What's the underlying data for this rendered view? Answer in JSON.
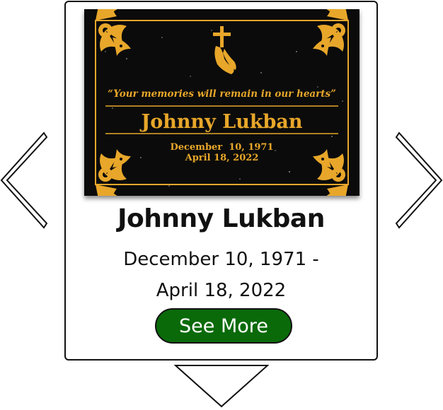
{
  "plaque": {
    "quote": "“Your memories will remain in our hearts”",
    "name": "Johnny Lukban",
    "date_line_1": "December  10, 1971",
    "date_line_2": "April 18, 2022",
    "colors": {
      "background": "#0b0b0b",
      "gold": "#e8a72a"
    }
  },
  "card": {
    "name": "Johnny Lukban",
    "dates_line_1": "December 10, 1971 -",
    "dates_line_2": "April 18, 2022",
    "button_label": "See More",
    "button_color": "#0a6a0a"
  },
  "navigation": {
    "left_icon": "chevron-left-icon",
    "right_icon": "chevron-right-icon",
    "down_icon": "triangle-down-icon"
  }
}
